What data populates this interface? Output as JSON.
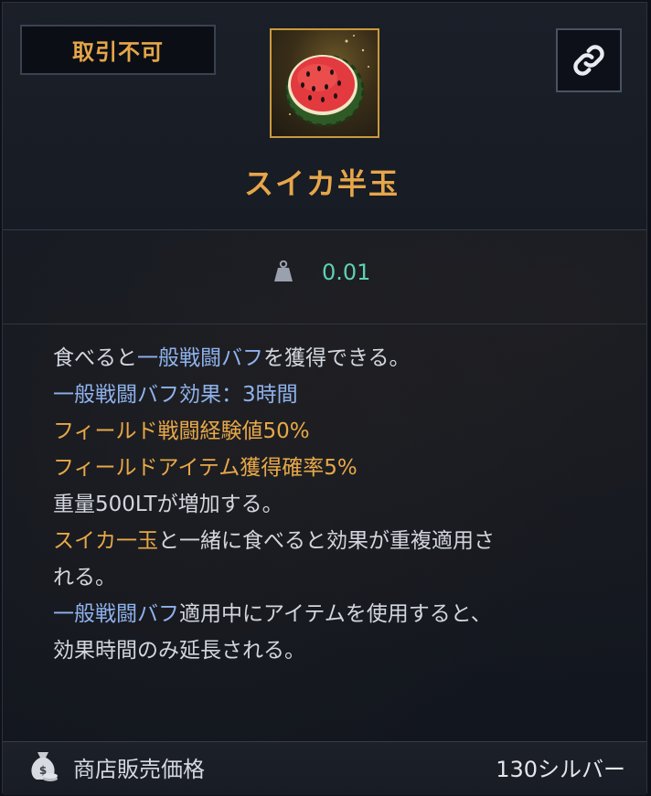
{
  "badge": {
    "label": "取引不可"
  },
  "item": {
    "name": "スイカ半玉",
    "icon": "watermelon-half-icon"
  },
  "link_button": {
    "icon": "link-icon"
  },
  "weight": {
    "icon": "weight-icon",
    "value": "0.01"
  },
  "description": {
    "lines": [
      [
        {
          "text": "食べると",
          "color": "white"
        },
        {
          "text": "一般戦闘バフ",
          "color": "blue"
        },
        {
          "text": "を獲得できる。",
          "color": "white"
        }
      ],
      [
        {
          "text": "一般戦闘バフ効果：3時間",
          "color": "blue"
        }
      ],
      [
        {
          "text": "フィールド戦闘経験値50%",
          "color": "gold"
        }
      ],
      [
        {
          "text": "フィールドアイテム獲得確率5%",
          "color": "gold"
        }
      ],
      [
        {
          "text": "重量500LTが増加する。",
          "color": "white"
        }
      ],
      [
        {
          "text": "スイカ一玉",
          "color": "gold"
        },
        {
          "text": "と一緒に食べると効果が重複適用さ",
          "color": "white"
        }
      ],
      [
        {
          "text": "れる。",
          "color": "white"
        }
      ],
      [
        {
          "text": "一般戦闘バフ",
          "color": "blue"
        },
        {
          "text": "適用中にアイテムを使用すると、",
          "color": "white"
        }
      ],
      [
        {
          "text": "効果時間のみ延長される。",
          "color": "white"
        }
      ]
    ]
  },
  "footer": {
    "icon": "coin-bag-icon",
    "label": "商店販売価格",
    "price": "130シルバー"
  },
  "colors": {
    "gold": "#e8a848",
    "blue": "#8fb2ec",
    "teal": "#5ed0b4",
    "white": "#d3d6de"
  }
}
